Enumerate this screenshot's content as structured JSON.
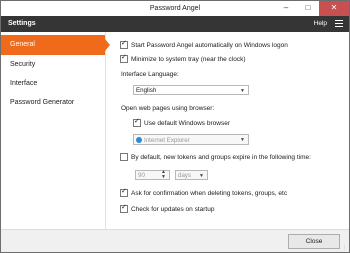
{
  "window": {
    "title": "Password Angel"
  },
  "menubar": {
    "title": "Settings",
    "help": "Help"
  },
  "sidebar": {
    "items": [
      {
        "label": "General",
        "active": true
      },
      {
        "label": "Security",
        "active": false
      },
      {
        "label": "Interface",
        "active": false
      },
      {
        "label": "Password Generator",
        "active": false
      }
    ]
  },
  "general": {
    "start_logon": {
      "label": "Start Password Angel automatically on Windows logon",
      "checked": true
    },
    "minimize_tray": {
      "label": "Minimize to system tray (near the clock)",
      "checked": true
    },
    "interface_language_label": "Interface Language:",
    "interface_language_value": "English",
    "open_web_label": "Open web pages using browser:",
    "use_default_browser": {
      "label": "Use default Windows browser",
      "checked": true
    },
    "browser_value": "Internet Explorer",
    "expire": {
      "label": "By default, new tokens and groups expire in the following time:",
      "checked": false
    },
    "expire_amount": "90",
    "expire_unit": "days",
    "ask_confirmation": {
      "label": "Ask for confirmation when deleting tokens, groups, etc",
      "checked": true
    },
    "check_updates": {
      "label": "Check for updates on startup",
      "checked": true
    }
  },
  "footer": {
    "close_label": "Close"
  },
  "colors": {
    "accent": "#ef6a1a",
    "menubar": "#353535",
    "close_control": "#c75050"
  }
}
